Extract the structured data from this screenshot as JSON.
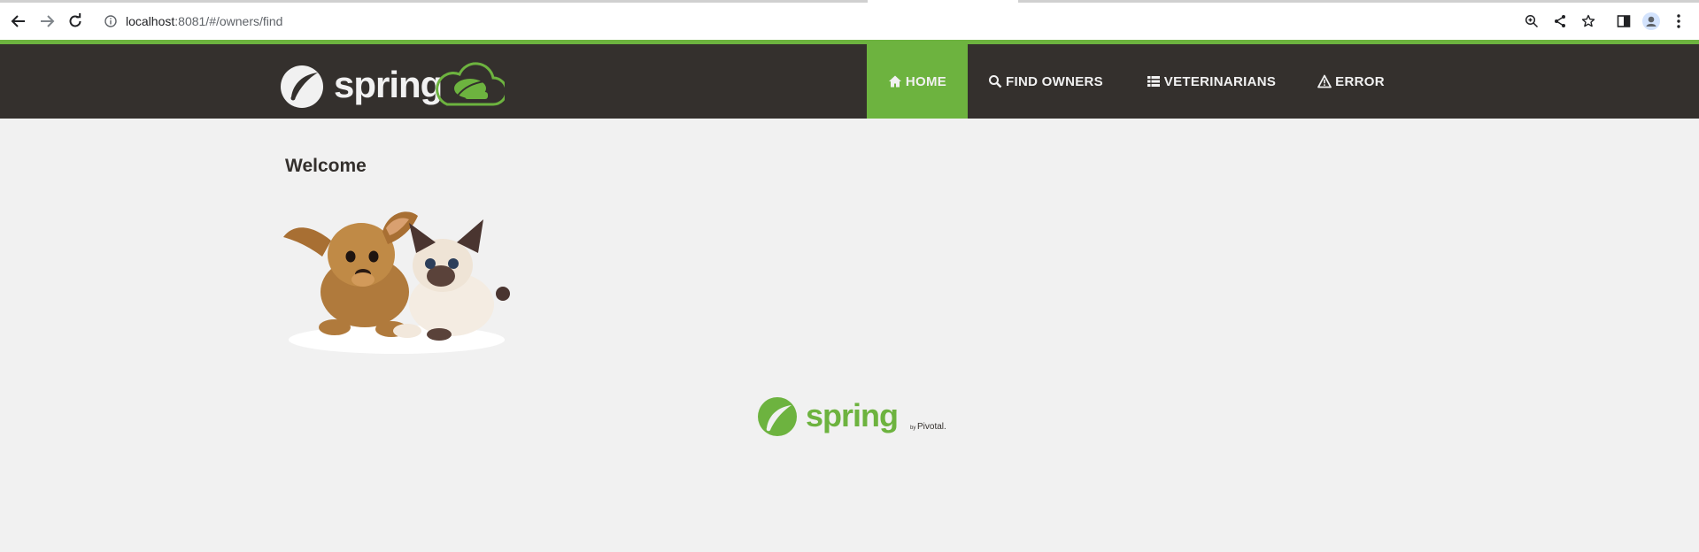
{
  "browser": {
    "url_host": "localhost",
    "url_rest": ":8081/#/owners/find"
  },
  "navbar": {
    "brand_text": "spring",
    "items": [
      {
        "label": "HOME",
        "icon": "home-icon",
        "active": true
      },
      {
        "label": "FIND OWNERS",
        "icon": "search-icon",
        "active": false
      },
      {
        "label": "VETERINARIANS",
        "icon": "list-icon",
        "active": false
      },
      {
        "label": "ERROR",
        "icon": "warning-icon",
        "active": false
      }
    ]
  },
  "main": {
    "title": "Welcome",
    "image": "pets-image"
  },
  "footer": {
    "logo_text": "spring",
    "by_text": "by",
    "company_text": "Pivotal."
  },
  "colors": {
    "accent": "#6db33f",
    "navbar_bg": "#34302d",
    "page_bg": "#f1f1f1"
  }
}
